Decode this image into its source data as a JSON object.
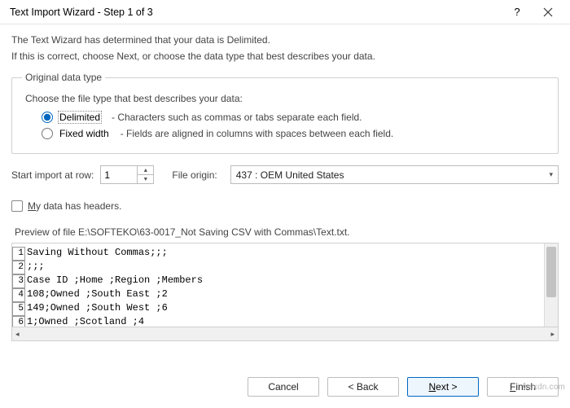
{
  "titlebar": {
    "title": "Text Import Wizard - Step 1 of 3"
  },
  "intro": {
    "line1": "The Text Wizard has determined that your data is Delimited.",
    "line2": "If this is correct, choose Next, or choose the data type that best describes your data."
  },
  "groupbox": {
    "legend": "Original data type",
    "choose": "Choose the file type that best describes your data:",
    "delimited": {
      "label": "Delimited",
      "desc": "- Characters such as commas or tabs separate each field."
    },
    "fixed": {
      "label": "Fixed width",
      "desc": "- Fields are aligned in columns with spaces between each field."
    }
  },
  "start_row": {
    "label": "Start import at row:",
    "value": "1"
  },
  "file_origin": {
    "label": "File origin:",
    "value": "437 : OEM United States"
  },
  "headers_checkbox": {
    "prefix_underlined": "M",
    "rest": "y data has headers."
  },
  "preview": {
    "label": "Preview of file E:\\SOFTEKO\\63-0017_Not Saving CSV with Commas\\Text.txt.",
    "lines": [
      "Saving Without Commas;;;",
      ";;;",
      "Case ID ;Home ;Region ;Members",
      "108;Owned ;South East ;2",
      "149;Owned ;South West ;6",
      "1;Owned ;Scotland ;4"
    ]
  },
  "buttons": {
    "cancel": "Cancel",
    "back": "< Back",
    "next_underlined": "N",
    "next_rest": "ext >",
    "finish_underlined": "F",
    "finish_rest": "inish"
  },
  "watermark": "wsxdn.com"
}
